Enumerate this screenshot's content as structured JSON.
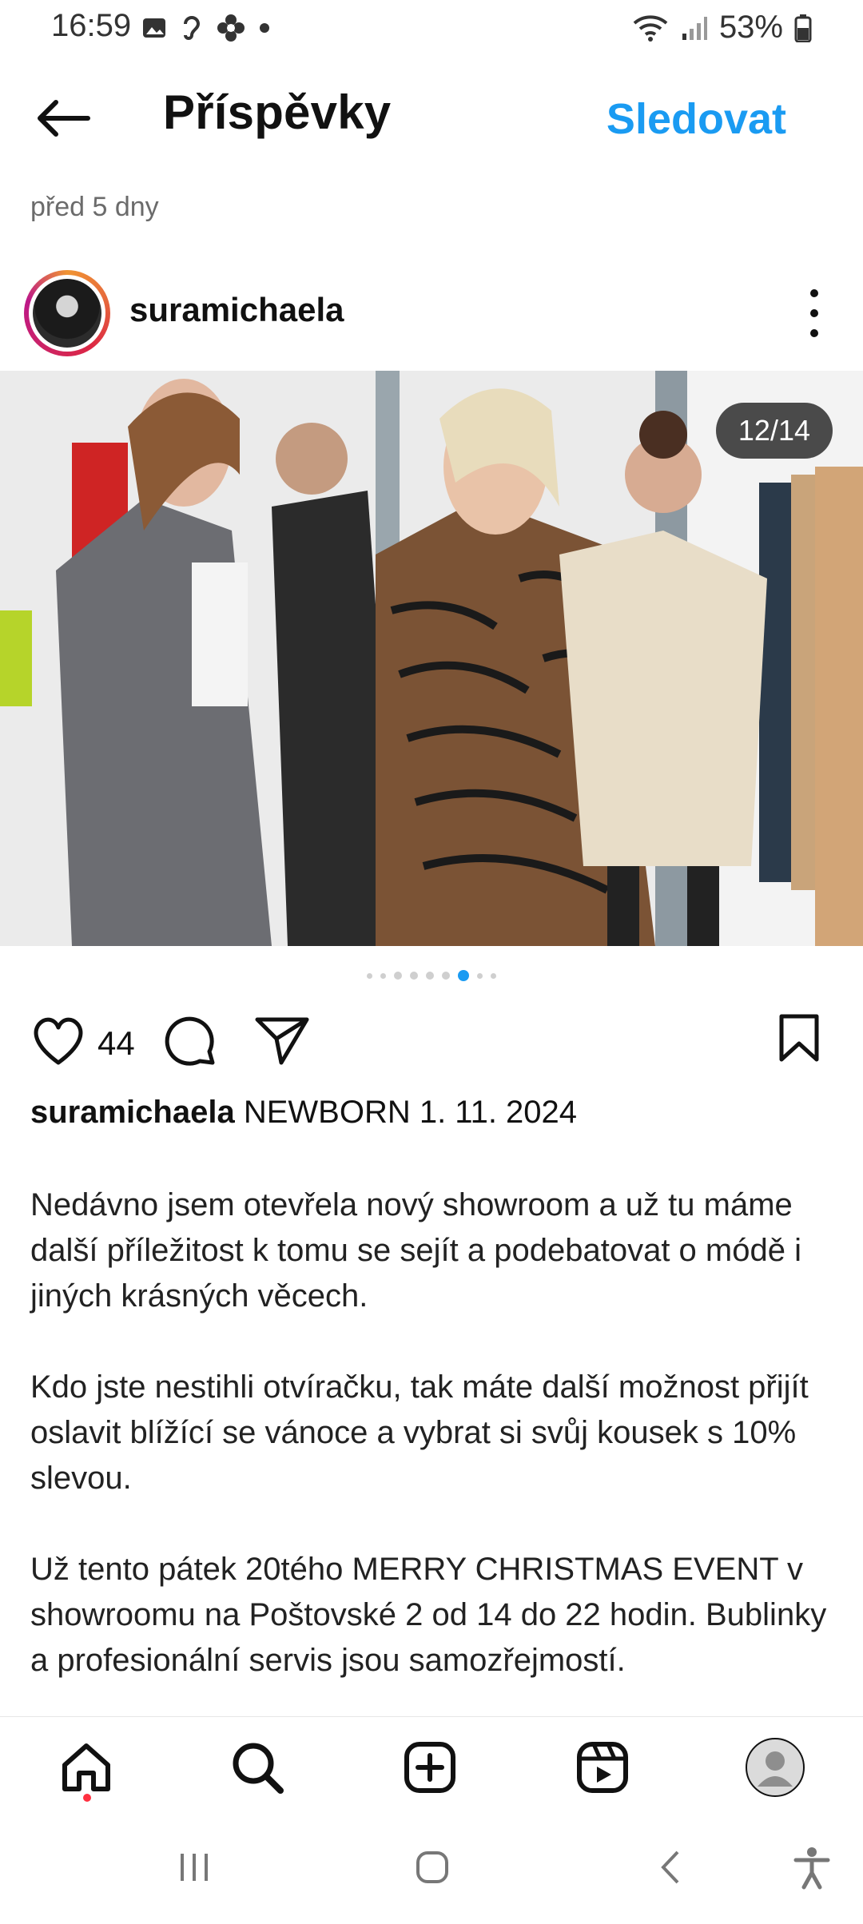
{
  "status_bar": {
    "time": "16:59",
    "battery": "53%",
    "icons_left": [
      "gallery-icon",
      "ear-icon",
      "flower-icon",
      "dot-icon"
    ],
    "icons_right": [
      "wifi-icon",
      "signal-icon",
      "battery-icon"
    ]
  },
  "header": {
    "title": "Příspěvky",
    "follow_label": "Sledovat",
    "back_icon": "arrow-left-icon"
  },
  "post": {
    "time_ago": "před 5 dny",
    "username": "suramichaela",
    "image_counter": "12/14",
    "like_count": "44",
    "caption_headline": "NEWBORN 1. 11. 2024",
    "caption_paragraphs": [
      "Nedávno jsem otevřela nový showroom a už tu máme další příležitost k tomu se sejít a podebatovat o módě i jiných krásných věcech.",
      "Kdo jste nestihli otvíračku, tak máte další možnost přijít oslavit blížící se vánoce a vybrat si svůj kousek s 10% slevou.",
      "Už tento pátek 20tého MERRY CHRISTMAS EVENT v showroomu na Poštovské 2 od 14 do 22 hodin. Bublinky a profesionální servis jsou samozřejmostí."
    ]
  },
  "colors": {
    "accent": "#1A9BF2",
    "notification_dot": "#FF3040"
  }
}
